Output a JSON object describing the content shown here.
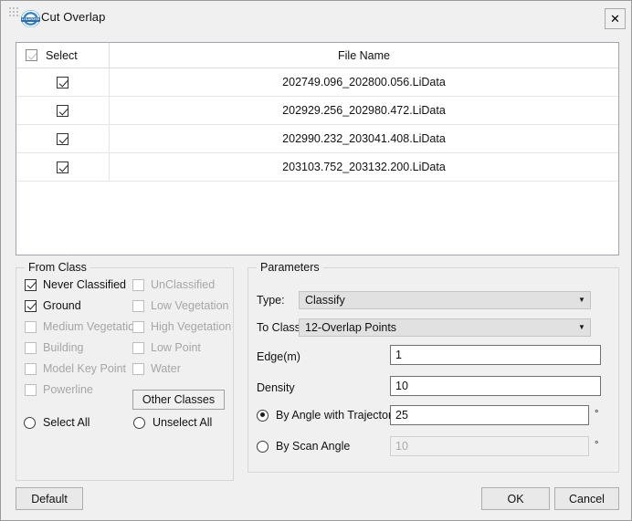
{
  "window": {
    "title": "Cut Overlap",
    "logo_text": "LiDAR360",
    "close_label": "✕"
  },
  "file_table": {
    "columns": {
      "select": "Select",
      "file_name": "File Name"
    },
    "header_checkbox_state": "partial",
    "rows": [
      {
        "checked": true,
        "file_name": "202749.096_202800.056.LiData"
      },
      {
        "checked": true,
        "file_name": "202929.256_202980.472.LiData"
      },
      {
        "checked": true,
        "file_name": "202990.232_203041.408.LiData"
      },
      {
        "checked": true,
        "file_name": "203103.752_203132.200.LiData"
      }
    ]
  },
  "from_class": {
    "legend": "From Class",
    "left_column": [
      {
        "label": "Never Classified",
        "checked": true,
        "enabled": true
      },
      {
        "label": "Ground",
        "checked": true,
        "enabled": true
      },
      {
        "label": "Medium Vegetation",
        "checked": false,
        "enabled": false
      },
      {
        "label": "Building",
        "checked": false,
        "enabled": false
      },
      {
        "label": "Model Key Point",
        "checked": false,
        "enabled": false
      },
      {
        "label": "Powerline",
        "checked": false,
        "enabled": false
      }
    ],
    "right_column": [
      {
        "label": "UnClassified",
        "checked": false,
        "enabled": false
      },
      {
        "label": "Low Vegetation",
        "checked": false,
        "enabled": false
      },
      {
        "label": "High Vegetation",
        "checked": false,
        "enabled": false
      },
      {
        "label": "Low Point",
        "checked": false,
        "enabled": false
      },
      {
        "label": "Water",
        "checked": false,
        "enabled": false
      }
    ],
    "other_classes_button": "Other Classes",
    "select_all": {
      "label": "Select All",
      "selected": false
    },
    "unselect_all": {
      "label": "Unselect All",
      "selected": false
    }
  },
  "parameters": {
    "legend": "Parameters",
    "type": {
      "label": "Type:",
      "value": "Classify"
    },
    "to_class": {
      "label": "To Class:",
      "value": "12-Overlap Points"
    },
    "edge": {
      "label": "Edge(m)",
      "value": "1"
    },
    "density": {
      "label": "Density",
      "value": "10"
    },
    "by_angle_with_trajectory": {
      "label": "By Angle with Trajectory",
      "selected": true,
      "value": "25",
      "unit": "°",
      "enabled": true
    },
    "by_scan_angle": {
      "label": "By Scan Angle",
      "selected": false,
      "value": "10",
      "unit": "°",
      "enabled": false
    }
  },
  "footer": {
    "default_label": "Default",
    "ok_label": "OK",
    "cancel_label": "Cancel"
  }
}
